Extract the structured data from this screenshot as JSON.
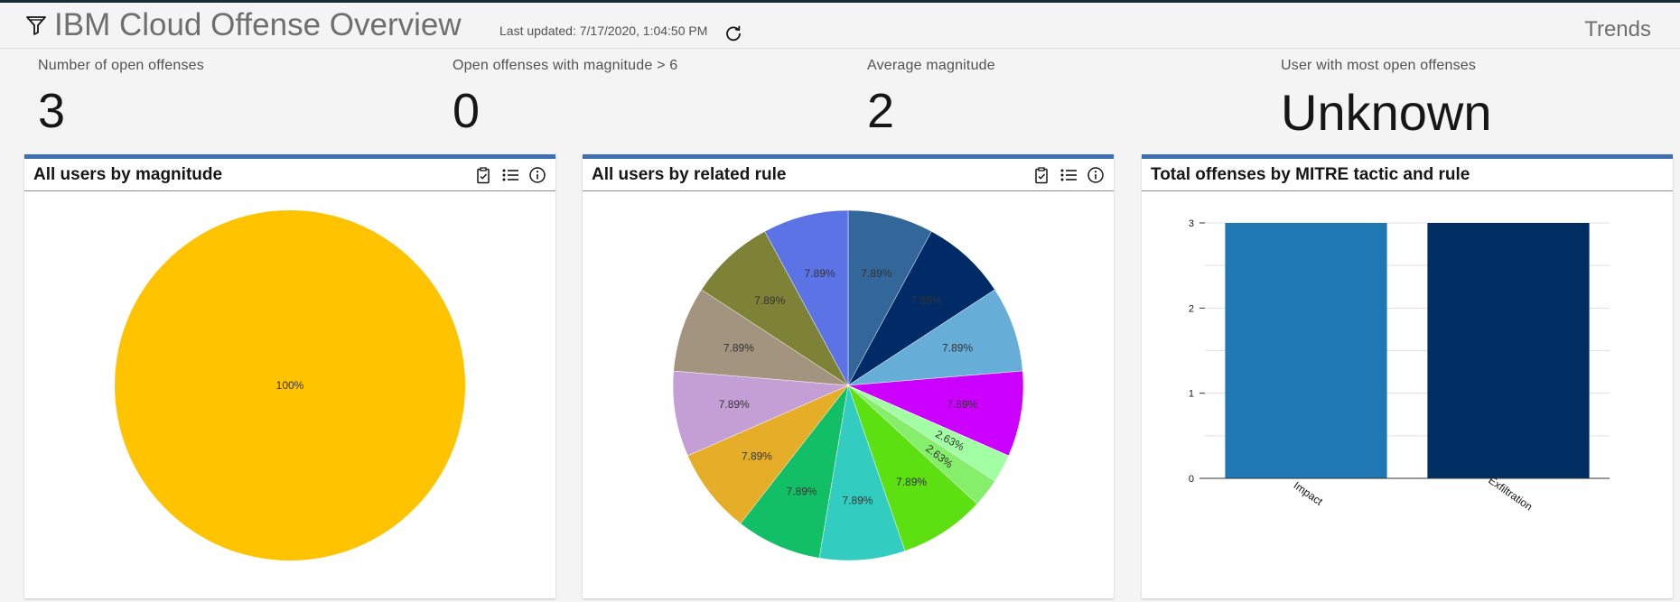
{
  "header": {
    "title": "IBM Cloud Offense Overview",
    "last_updated": "Last updated: 7/17/2020, 1:04:50 PM",
    "trends_label": "Trends"
  },
  "kpis": [
    {
      "label": "Number of open offenses",
      "value": "3"
    },
    {
      "label": "Open offenses with magnitude > 6",
      "value": "0"
    },
    {
      "label": "Average magnitude",
      "value": "2"
    },
    {
      "label": "User with most open offenses",
      "value": "Unknown"
    }
  ],
  "cards": [
    {
      "title": "All users by magnitude"
    },
    {
      "title": "All users by related rule"
    },
    {
      "title": "Total offenses by MITRE tactic and rule"
    }
  ],
  "colors": {
    "accent": "#3d70b2",
    "pie1": "#ffc300"
  },
  "chart_data": [
    {
      "type": "pie",
      "title": "All users by magnitude",
      "slices": [
        {
          "value": 100,
          "label": "100%",
          "color": "#ffc300"
        }
      ]
    },
    {
      "type": "pie",
      "title": "All users by related rule",
      "slices": [
        {
          "value": 7.89,
          "label": "7.89%",
          "color": "#336699"
        },
        {
          "value": 7.89,
          "label": "7.89%",
          "color": "#002b66"
        },
        {
          "value": 7.89,
          "label": "7.89%",
          "color": "#66aed8"
        },
        {
          "value": 7.89,
          "label": "7.89%",
          "color": "#cc00ff"
        },
        {
          "value": 2.63,
          "label": "2.63%",
          "color": "#a3ffa3"
        },
        {
          "value": 2.63,
          "label": "2.63%",
          "color": "#85ee6a"
        },
        {
          "value": 7.89,
          "label": "7.89%",
          "color": "#5ce012"
        },
        {
          "value": 7.89,
          "label": "7.89%",
          "color": "#33ccc0"
        },
        {
          "value": 7.89,
          "label": "7.89%",
          "color": "#12bf66"
        },
        {
          "value": 7.89,
          "label": "7.89%",
          "color": "#e6ad29"
        },
        {
          "value": 7.89,
          "label": "7.89%",
          "color": "#c49fd6"
        },
        {
          "value": 7.89,
          "label": "7.89%",
          "color": "#a39480"
        },
        {
          "value": 7.89,
          "label": "7.89%",
          "color": "#7d8236"
        },
        {
          "value": 7.89,
          "label": "7.89%",
          "color": "#5c73e6"
        }
      ]
    },
    {
      "type": "bar",
      "title": "Total offenses by MITRE tactic and rule",
      "categories": [
        "Impact",
        "Exfiltration"
      ],
      "values": [
        3,
        3
      ],
      "colors": [
        "#1f77b4",
        "#002d62"
      ],
      "yticks": [
        "0",
        "1",
        "2",
        "3"
      ],
      "ylim": [
        0,
        3
      ],
      "grid": true
    }
  ]
}
